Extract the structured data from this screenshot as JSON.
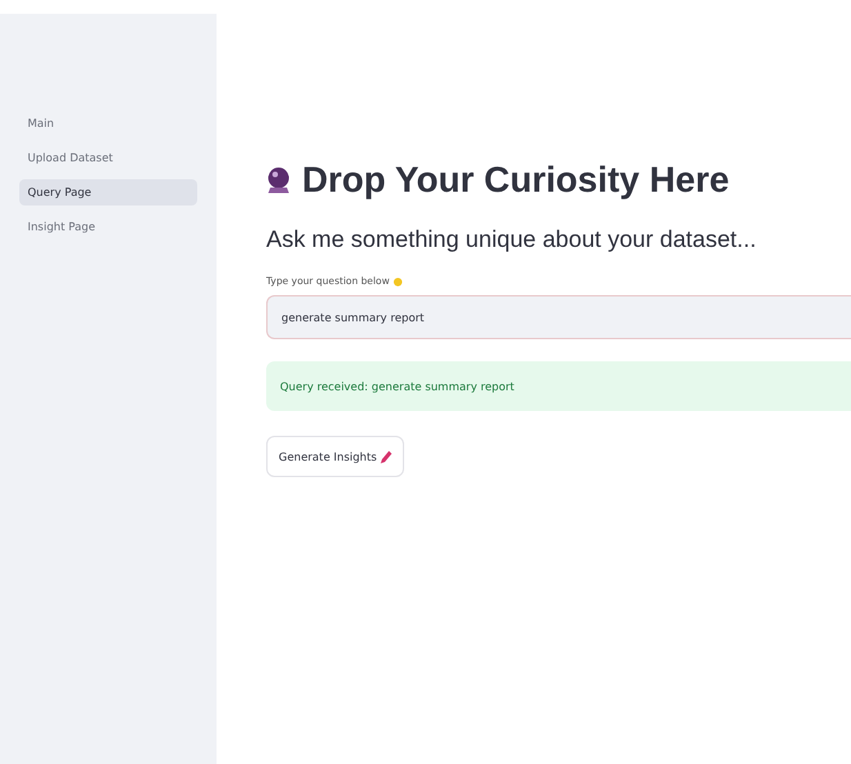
{
  "sidebar": {
    "items": [
      {
        "label": "Main",
        "selected": false
      },
      {
        "label": "Upload Dataset",
        "selected": false
      },
      {
        "label": "Query Page",
        "selected": true
      },
      {
        "label": "Insight Page",
        "selected": false
      }
    ]
  },
  "main": {
    "title": "Drop Your Curiosity Here",
    "subtitle": "Ask me something unique about your dataset...",
    "field": {
      "label": "Type your question below",
      "value": "generate summary report"
    },
    "alert": {
      "kind": "success",
      "text": "Query received: generate summary report"
    },
    "button": {
      "label": "Generate Insights"
    }
  }
}
